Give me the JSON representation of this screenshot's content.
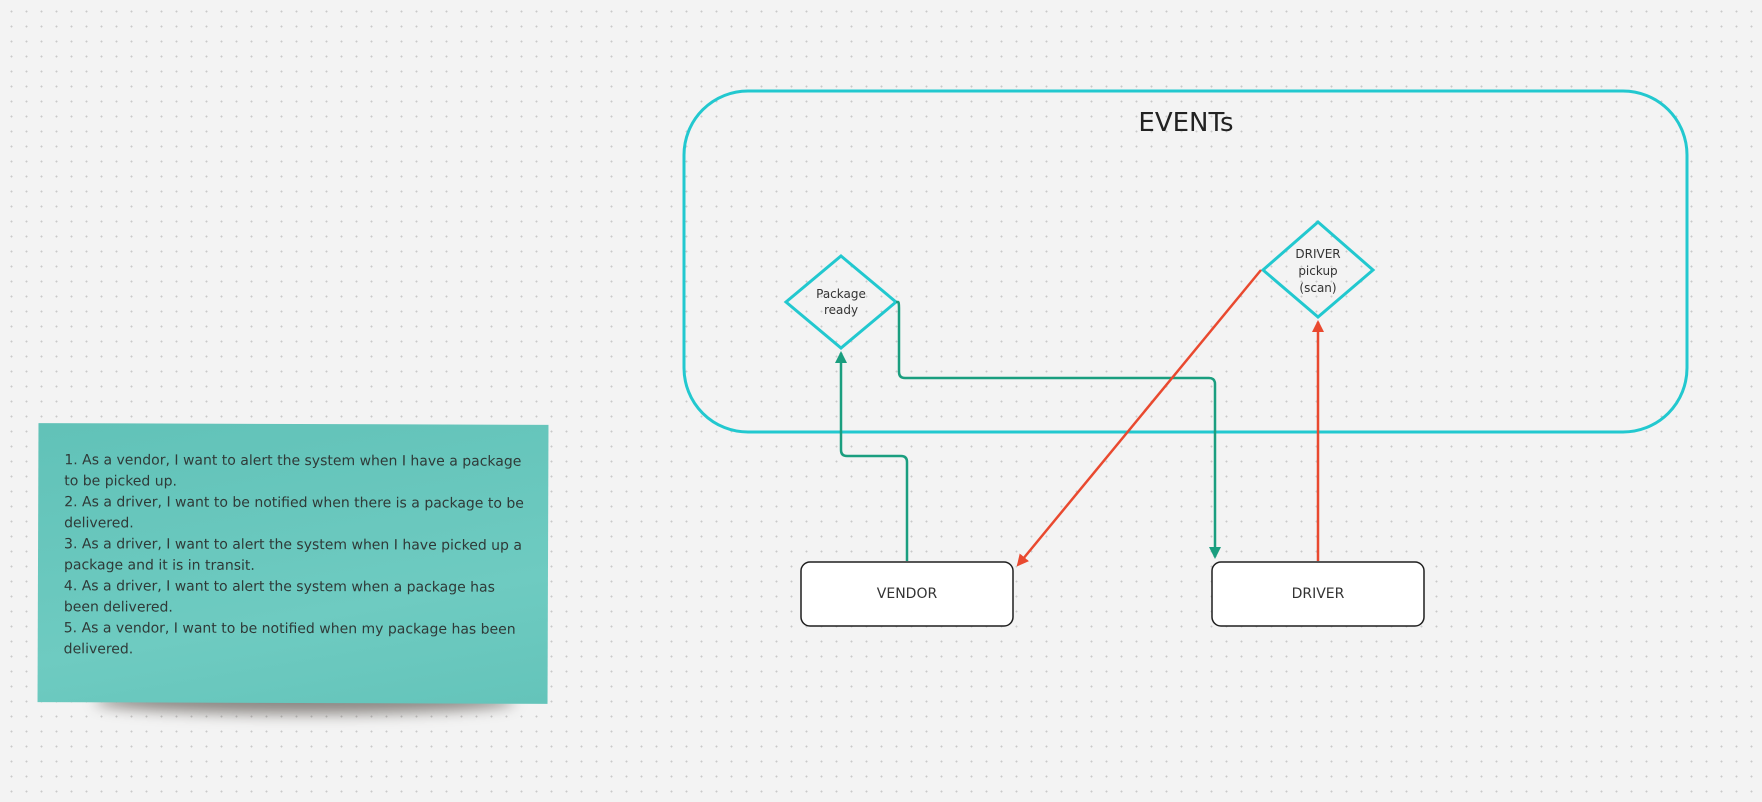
{
  "board": {
    "background": "#f3f3f3",
    "dot_color": "#c9c9c9"
  },
  "sticky_note": {
    "color": "#6bc9bf",
    "items": [
      "1. As a vendor, I want to alert the system when I have a package to be picked up.",
      "2. As a driver, I want to be notified when there is a package to be delivered.",
      "3. As a driver, I want to alert the system when I have picked up a package and it is in transit.",
      "4. As a driver, I want to alert the system when a package has been delivered.",
      "5. As a vendor, I want to be notified when my package has been delivered."
    ]
  },
  "diagram": {
    "container": {
      "title": "EVENTs",
      "border_color": "#22c8cf"
    },
    "events": {
      "package_ready": {
        "line1": "Package",
        "line2": "ready"
      },
      "driver_pickup": {
        "line1": "DRIVER",
        "line2": "pickup",
        "line3": "(scan)"
      }
    },
    "actors": {
      "vendor": "VENDOR",
      "driver": "DRIVER"
    },
    "colors": {
      "green_connector": "#1a9e7f",
      "red_connector": "#e9492f",
      "event_outline": "#22c8cf",
      "actor_outline": "#1f1f1f"
    }
  }
}
